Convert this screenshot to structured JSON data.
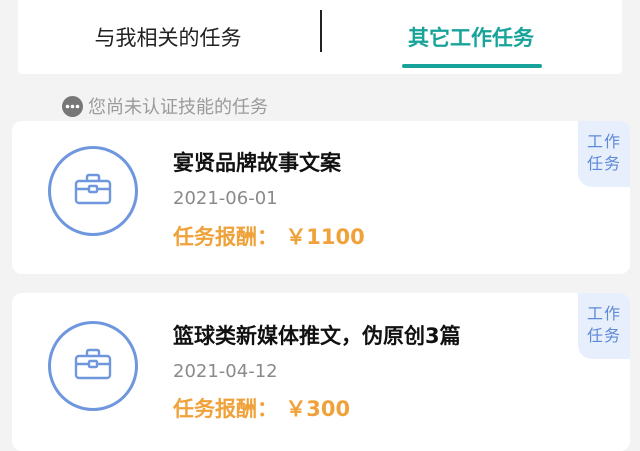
{
  "tabs": {
    "related_label": "与我相关的任务",
    "other_label": "其它工作任务"
  },
  "notice": {
    "text": "您尚未认证技能的任务",
    "icon": "more-dots-icon"
  },
  "tasks": [
    {
      "badge": "工作任务",
      "badge_line1": "工作",
      "badge_line2": "任务",
      "title": "宴贤品牌故事文案",
      "date": "2021-06-01",
      "pay_label": "任务报酬：",
      "pay_value": "￥1100",
      "icon": "briefcase-icon"
    },
    {
      "badge": "工作任务",
      "badge_line1": "工作",
      "badge_line2": "任务",
      "title": "篮球类新媒体推文，伪原创3篇",
      "date": "2021-04-12",
      "pay_label": "任务报酬：",
      "pay_value": "￥300",
      "icon": "briefcase-icon"
    }
  ],
  "colors": {
    "accent": "#17a39a",
    "icon_blue": "#6e97de",
    "pay_orange": "#f0a23a",
    "badge_bg": "#e7eefc"
  }
}
